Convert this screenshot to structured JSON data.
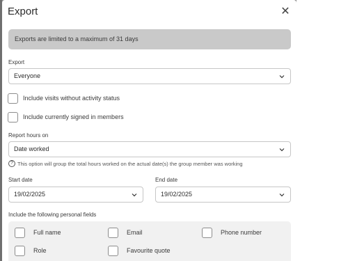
{
  "modal": {
    "title": "Export",
    "close_icon": "close-icon",
    "banner_text": "Exports are limited to a maximum of 31 days"
  },
  "export": {
    "label": "Export",
    "selected": "Everyone"
  },
  "checkboxes": {
    "visits_without_status": {
      "label": "Include visits without activity status",
      "checked": false
    },
    "signed_in_members": {
      "label": "Include currently signed in members",
      "checked": false
    }
  },
  "report_hours": {
    "label": "Report hours on",
    "selected": "Date worked",
    "hint": "This option will group the total hours worked on the actual date(s) the group member was working"
  },
  "dates": {
    "start_label": "Start date",
    "start_value": "19/02/2025",
    "end_label": "End date",
    "end_value": "19/02/2025"
  },
  "personal_fields": {
    "label": "Include the following personal fields",
    "items": [
      {
        "label": "Full name",
        "checked": false
      },
      {
        "label": "Email",
        "checked": false
      },
      {
        "label": "Phone number",
        "checked": false
      },
      {
        "label": "Role",
        "checked": false
      },
      {
        "label": "Favourite quote",
        "checked": false
      }
    ]
  }
}
